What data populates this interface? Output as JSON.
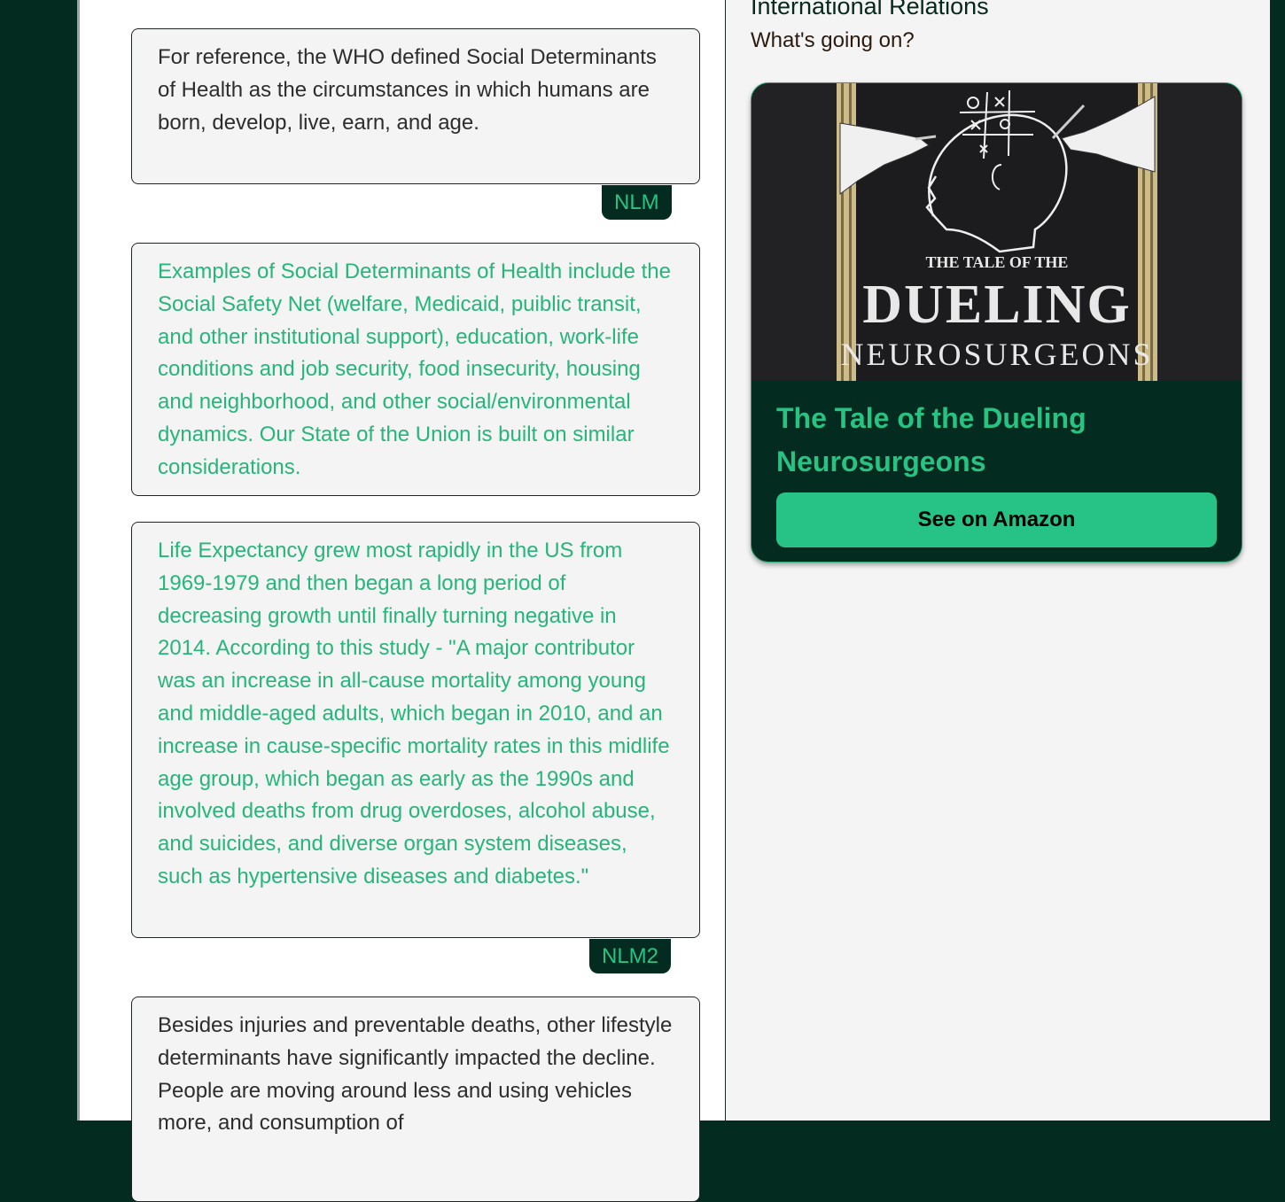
{
  "main": {
    "cards": [
      {
        "text": "For reference, the WHO defined Social Determinants of Health as the circumstances in which humans are born, develop, live, earn, and age.",
        "tag": "NLM"
      },
      {
        "text": "Examples of Social Determinants of Health include the Social Safety Net (welfare, Medicaid, puiblic transit, and other institutional support), education, work-life conditions and job security, food insecurity, housing and neighborhood, and other social/environmental dynamics. Our State of the Union is built on similar considerations."
      },
      {
        "text": "Life Expectancy grew most rapidly in the US from 1969-1979 and then began a long period of decreasing growth until finally turning negative in 2014. According to this study - \"A major contributor was an increase in all-cause mortality among young and middle-aged adults, which began in 2010, and an increase in cause-specific mortality rates in this midlife age group, which began as early as the 1990s and involved deaths from drug overdoses, alcohol abuse, and suicides, and diverse organ system diseases, such as hypertensive diseases and diabetes.\"",
        "tag": "NLM2"
      },
      {
        "text": "Besides injuries and preventable deaths, other lifestyle determinants have significantly impacted the decline. People are moving around less and using vehicles more, and consumption of"
      }
    ]
  },
  "sidebar": {
    "section_title": "International Relations",
    "section_subtitle": "What's going on?",
    "book": {
      "cover_small": "THE TALE OF THE",
      "cover_title": "DUELING",
      "cover_sub": "NEUROSURGEONS",
      "title": "The Tale of the Dueling Neurosurgeons",
      "button": "See on Amazon"
    }
  },
  "colors": {
    "dark_green": "#032b1f",
    "accent_green": "#27c386",
    "card_bg": "#f4f4f4"
  }
}
